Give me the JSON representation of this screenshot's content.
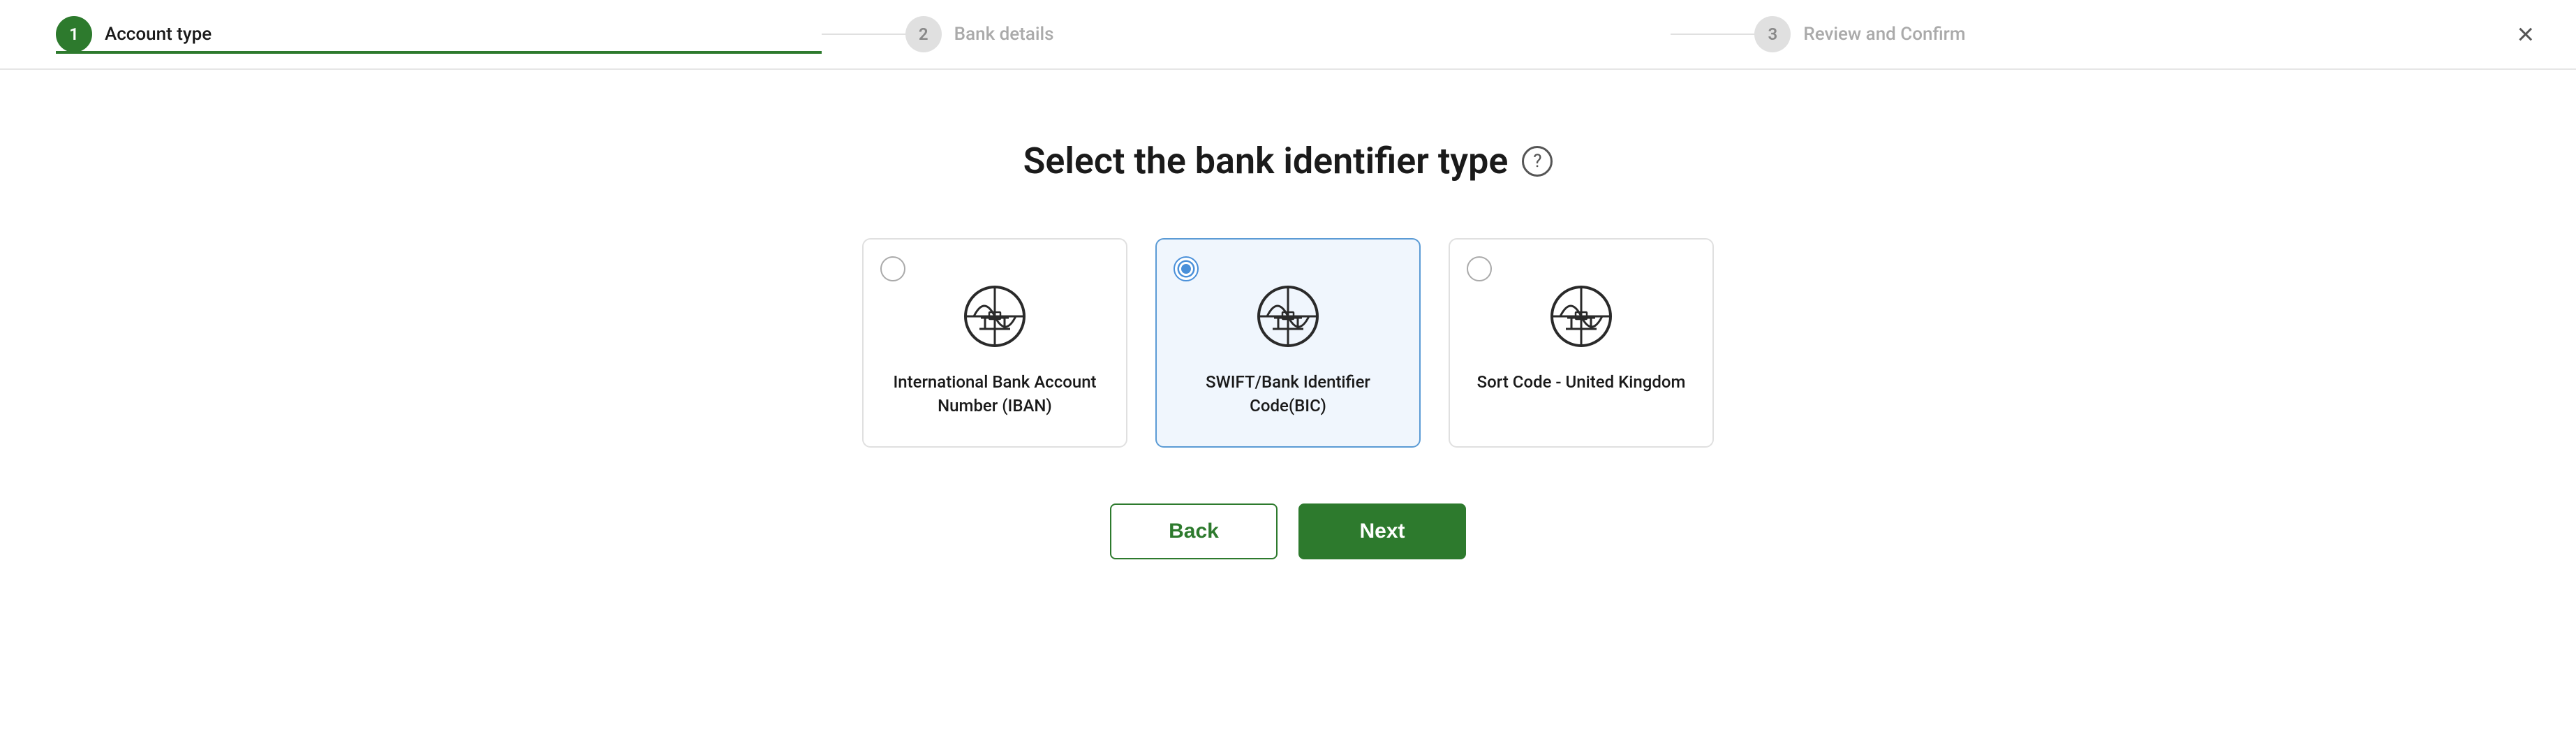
{
  "header": {
    "close_label": "×",
    "steps": [
      {
        "number": "1",
        "label": "Account type",
        "state": "active"
      },
      {
        "number": "2",
        "label": "Bank details",
        "state": "inactive"
      },
      {
        "number": "3",
        "label": "Review and Confirm",
        "state": "inactive"
      }
    ]
  },
  "main": {
    "title": "Select the bank identifier type",
    "help_icon": "?",
    "cards": [
      {
        "id": "iban",
        "label": "International Bank Account Number (IBAN)",
        "selected": false
      },
      {
        "id": "bic",
        "label": "SWIFT/Bank Identifier Code(BIC)",
        "selected": true
      },
      {
        "id": "sort-code",
        "label": "Sort Code - United Kingdom",
        "selected": false
      }
    ],
    "back_label": "Back",
    "next_label": "Next"
  }
}
